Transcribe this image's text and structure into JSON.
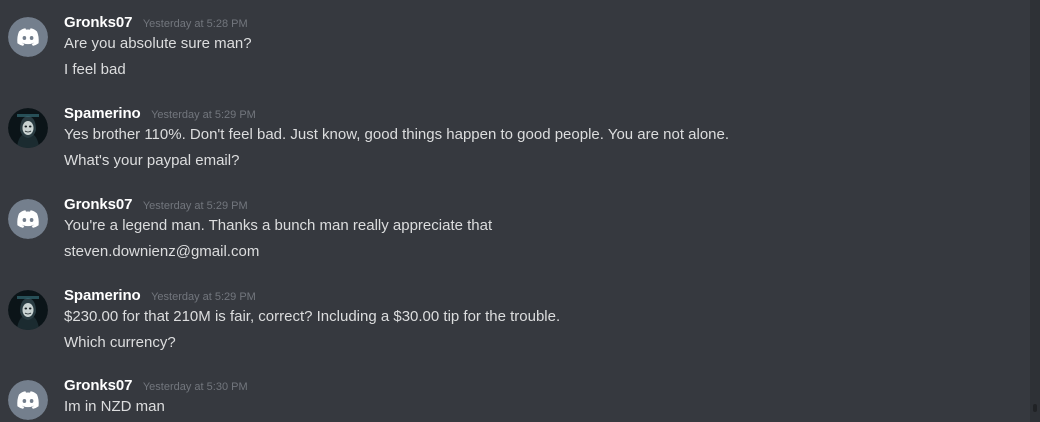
{
  "messages": [
    {
      "username": "Gronks07",
      "timestamp": "Yesterday at 5:28 PM",
      "avatar": "discord-default-avatar",
      "lines": [
        "Are you absolute sure man?",
        "I feel bad"
      ]
    },
    {
      "username": "Spamerino",
      "timestamp": "Yesterday at 5:29 PM",
      "avatar": "custom-avatar",
      "lines": [
        "Yes brother 110%. Don't feel bad. Just know, good things happen to good people. You are not alone.",
        "What's your paypal email?"
      ]
    },
    {
      "username": "Gronks07",
      "timestamp": "Yesterday at 5:29 PM",
      "avatar": "discord-default-avatar",
      "lines": [
        "You're a legend man. Thanks a bunch man really appreciate that",
        "steven.downienz@gmail.com"
      ]
    },
    {
      "username": "Spamerino",
      "timestamp": "Yesterday at 5:29 PM",
      "avatar": "custom-avatar",
      "lines": [
        "$230.00 for that 210M is fair, correct? Including a $30.00 tip for the trouble.",
        "Which currency?"
      ]
    },
    {
      "username": "Gronks07",
      "timestamp": "Yesterday at 5:30 PM",
      "avatar": "discord-default-avatar",
      "lines": [
        "Im in NZD man"
      ]
    }
  ],
  "colors": {
    "background": "#36393f",
    "username": "#ffffff",
    "message_text": "#dcddde",
    "timestamp": "#72767d",
    "default_avatar": "#747f8d"
  }
}
